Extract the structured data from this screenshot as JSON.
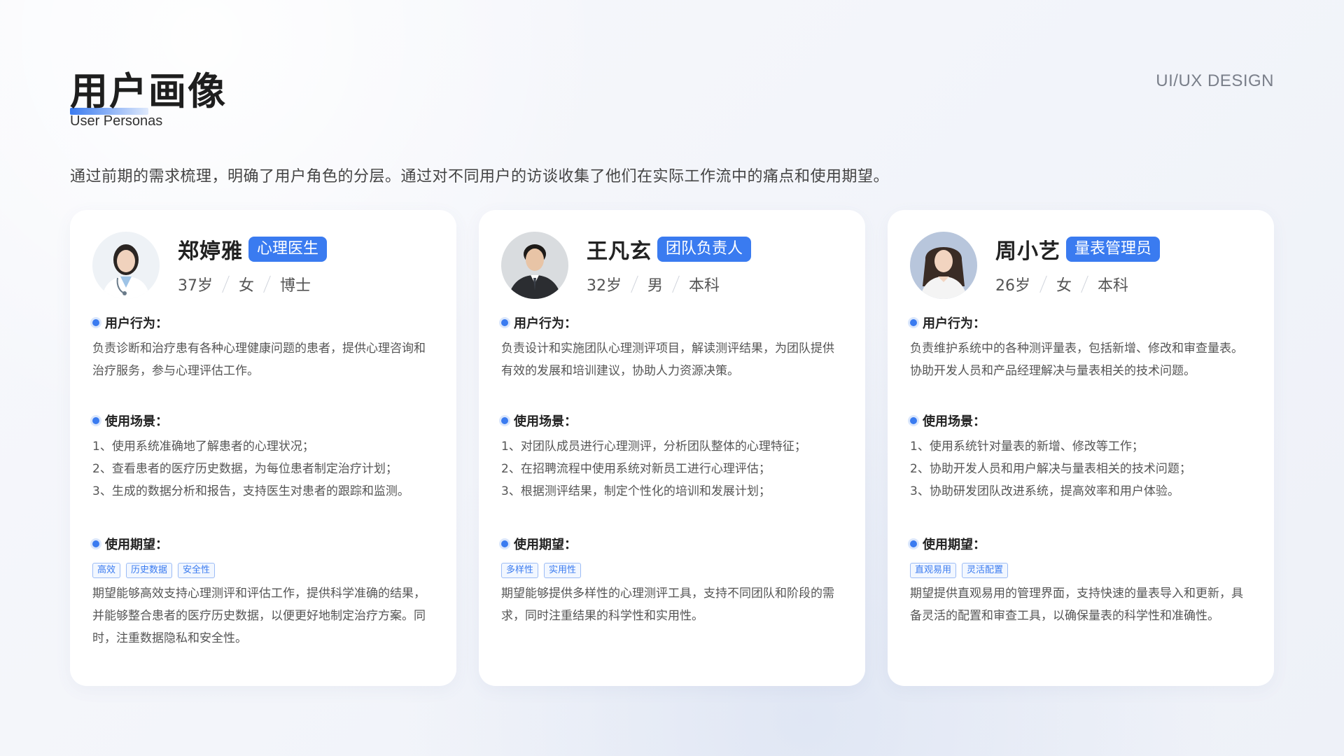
{
  "header": {
    "title": "用户画像",
    "subtitle": "User Personas",
    "brand": "UI/UX DESIGN",
    "intro": "通过前期的需求梳理，明确了用户角色的分层。通过对不同用户的访谈收集了他们在实际工作流中的痛点和使用期望。"
  },
  "colors": {
    "accent": "#3a7bf0"
  },
  "labels": {
    "behavior": "用户行为：",
    "scene": "使用场景：",
    "expect": "使用期望："
  },
  "personas": [
    {
      "name": "郑婷雅",
      "role": "心理医生",
      "age": "37岁",
      "gender": "女",
      "education": "博士",
      "behavior": "负责诊断和治疗患有各种心理健康问题的患者，提供心理咨询和治疗服务，参与心理评估工作。",
      "scenes": [
        "1、使用系统准确地了解患者的心理状况；",
        "2、查看患者的医疗历史数据，为每位患者制定治疗计划；",
        "3、生成的数据分析和报告，支持医生对患者的跟踪和监测。"
      ],
      "tags": [
        "高效",
        "历史数据",
        "安全性"
      ],
      "expect": "期望能够高效支持心理测评和评估工作，提供科学准确的结果，并能够整合患者的医疗历史数据，以便更好地制定治疗方案。同时，注重数据隐私和安全性。"
    },
    {
      "name": "王凡玄",
      "role": "团队负责人",
      "age": "32岁",
      "gender": "男",
      "education": "本科",
      "behavior": "负责设计和实施团队心理测评项目，解读测评结果，为团队提供有效的发展和培训建议，协助人力资源决策。",
      "scenes": [
        "1、对团队成员进行心理测评，分析团队整体的心理特征；",
        "2、在招聘流程中使用系统对新员工进行心理评估；",
        "3、根据测评结果，制定个性化的培训和发展计划；"
      ],
      "tags": [
        "多样性",
        "实用性"
      ],
      "expect": "期望能够提供多样性的心理测评工具，支持不同团队和阶段的需求，同时注重结果的科学性和实用性。"
    },
    {
      "name": "周小艺",
      "role": "量表管理员",
      "age": "26岁",
      "gender": "女",
      "education": "本科",
      "behavior": "负责维护系统中的各种测评量表，包括新增、修改和审查量表。协助开发人员和产品经理解决与量表相关的技术问题。",
      "scenes": [
        "1、使用系统针对量表的新增、修改等工作；",
        "2、协助开发人员和用户解决与量表相关的技术问题；",
        "3、协助研发团队改进系统，提高效率和用户体验。"
      ],
      "tags": [
        "直观易用",
        "灵活配置"
      ],
      "expect": "期望提供直观易用的管理界面，支持快速的量表导入和更新，具备灵活的配置和审查工具，以确保量表的科学性和准确性。"
    }
  ]
}
